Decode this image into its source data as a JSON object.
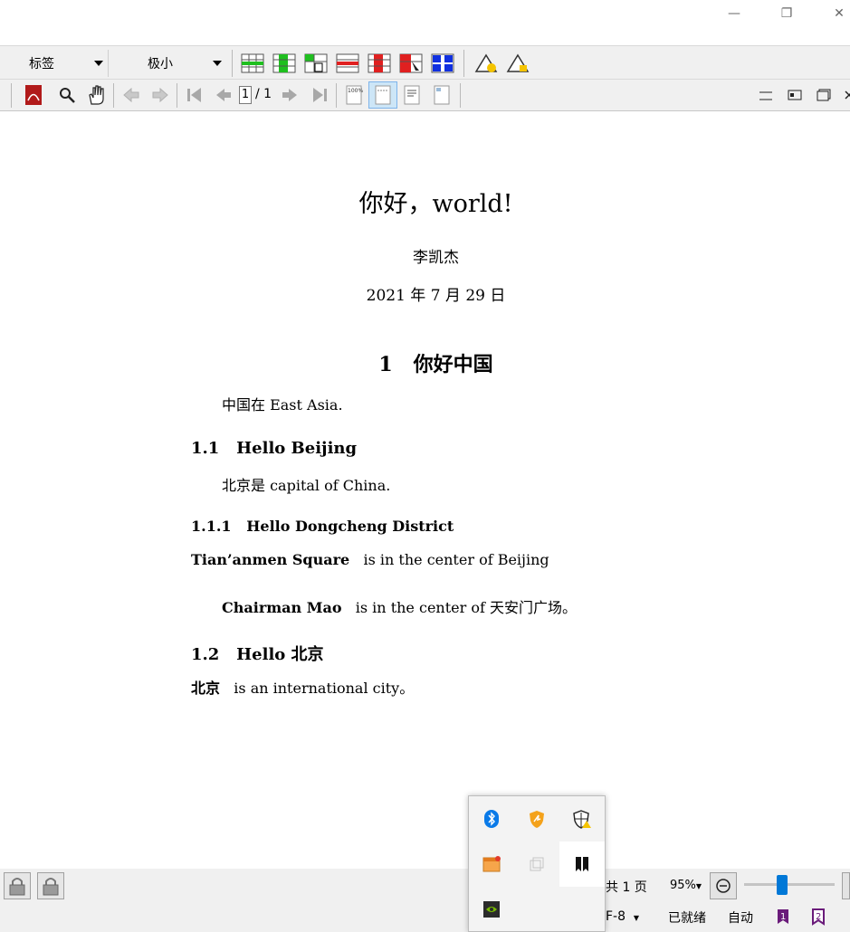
{
  "window": {
    "minimize_glyph": "—",
    "maximize_glyph": "❐",
    "close_glyph": "✕"
  },
  "toolbar1": {
    "tag_combo": "标签",
    "size_combo": "极小",
    "table_icons": [
      "insert-row-green-icon",
      "insert-column-green-icon",
      "insert-cell-icon",
      "delete-row-red-icon",
      "delete-column-red-icon",
      "delete-cell-icon",
      "merge-cells-blue-icon"
    ],
    "warning_icons": [
      "warning-icon",
      "warning-outline-icon"
    ]
  },
  "toolbar2": {
    "page_current": "1",
    "page_total": "/ 1",
    "icons": [
      "pdf-icon",
      "search-icon",
      "hand-icon",
      "back-icon",
      "forward-icon",
      "first-page-icon",
      "prev-page-icon",
      "next-page-icon",
      "last-page-icon",
      "zoom-100-icon",
      "fit-width-icon",
      "fit-page-icon",
      "continuous-icon",
      "minimize-panel-icon",
      "restore-panel-icon",
      "maximize-panel-icon"
    ]
  },
  "document": {
    "title": "你好，world!",
    "author": "李凯杰",
    "date": "2021 年 7 月 29 日",
    "section1_num": "1",
    "section1_title": "你好中国",
    "para1": "中国在 East Asia.",
    "sub11_num": "1.1",
    "sub11_title": "Hello Beijing",
    "para2": "北京是 capital of China.",
    "subsub111_num": "1.1.1",
    "subsub111_title": "Hello Dongcheng District",
    "para3_bold": "Tian’anmen Square",
    "para3_rest": "is in the center of Beijing",
    "para4_bold": "Chairman Mao",
    "para4_rest": "is in the center of 天安门广场。",
    "sub12_num": "1.2",
    "sub12_title": "Hello 北京",
    "para5_bold": "北京",
    "para5_rest": "is an international city。"
  },
  "statusbar": {
    "pages_label": "共 1 页",
    "zoom": "95%",
    "encoding": "F-8",
    "status": "已就绪",
    "mode": "自动"
  },
  "tray": {
    "icons": [
      "bluetooth-icon",
      "security-shield-icon",
      "defender-warning-icon",
      "app-window-icon",
      "copy-icon",
      "bookmark-app-icon",
      "nvidia-icon"
    ]
  },
  "colors": {
    "accent": "#0078d7",
    "toolbar_bg": "#f0f0f0"
  }
}
